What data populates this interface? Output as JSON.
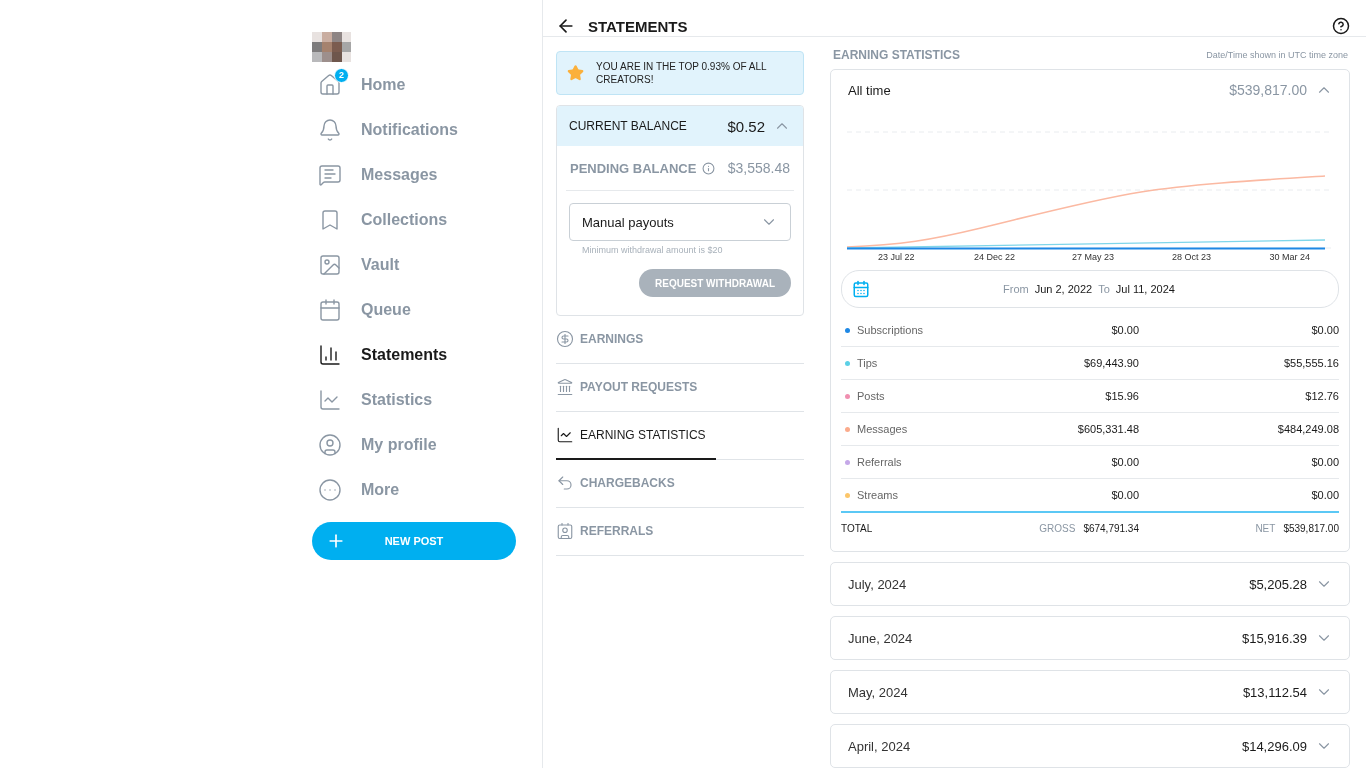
{
  "header": {
    "title": "STATEMENTS"
  },
  "sidebar": {
    "items": [
      {
        "label": "Home",
        "badge": "2",
        "selected": false
      },
      {
        "label": "Notifications",
        "selected": false
      },
      {
        "label": "Messages",
        "selected": false
      },
      {
        "label": "Collections",
        "selected": false
      },
      {
        "label": "Vault",
        "selected": false
      },
      {
        "label": "Queue",
        "selected": false
      },
      {
        "label": "Statements",
        "selected": true
      },
      {
        "label": "Statistics",
        "selected": false
      },
      {
        "label": "My profile",
        "selected": false
      },
      {
        "label": "More",
        "selected": false
      }
    ],
    "new_post": "NEW POST"
  },
  "rank_banner": "YOU ARE IN THE TOP 0.93% OF ALL CREATORS!",
  "balance": {
    "label": "CURRENT BALANCE",
    "amount": "$0.52",
    "expanded": true,
    "pending_label": "PENDING BALANCE",
    "pending_amount": "$3,558.48",
    "payout_mode": "Manual payouts",
    "hint": "Minimum withdrawal amount is $20",
    "withdraw_button": {
      "label": "REQUEST WITHDRAWAL",
      "disabled": true
    }
  },
  "tabs": [
    {
      "label": "EARNINGS",
      "selected": false
    },
    {
      "label": "PAYOUT REQUESTS",
      "selected": false
    },
    {
      "label": "EARNING STATISTICS",
      "selected": true
    },
    {
      "label": "CHARGEBACKS",
      "selected": false
    },
    {
      "label": "REFERRALS",
      "selected": false
    }
  ],
  "earning_statistics": {
    "title": "EARNING STATISTICS",
    "timezone_note": "Date/Time shown in UTC time zone",
    "summary": {
      "label": "All time",
      "amount": "$539,817.00",
      "expanded": true
    },
    "chart_x_labels": [
      "23 Jul 22",
      "24 Dec 22",
      "27 May 23",
      "28 Oct 23",
      "30 Mar 24"
    ],
    "date_range": {
      "from_label": "From",
      "from": "Jun 2, 2022",
      "to_label": "To",
      "to": "Jul 11, 2024"
    },
    "rows": [
      {
        "name": "Subscriptions",
        "color": "#1e88e5",
        "gross": "$0.00",
        "net": "$0.00"
      },
      {
        "name": "Tips",
        "color": "#5bd0e6",
        "gross": "$69,443.90",
        "net": "$55,555.16"
      },
      {
        "name": "Posts",
        "color": "#f08fb0",
        "gross": "$15.96",
        "net": "$12.76"
      },
      {
        "name": "Messages",
        "color": "#fbab8c",
        "gross": "$605,331.48",
        "net": "$484,249.08"
      },
      {
        "name": "Referrals",
        "color": "#c5a8e8",
        "gross": "$0.00",
        "net": "$0.00"
      },
      {
        "name": "Streams",
        "color": "#fcc66a",
        "gross": "$0.00",
        "net": "$0.00"
      }
    ],
    "total": {
      "label": "TOTAL",
      "gross_label": "GROSS",
      "gross": "$674,791.34",
      "net_label": "NET",
      "net": "$539,817.00"
    }
  },
  "months": [
    {
      "label": "July, 2024",
      "amount": "$5,205.28",
      "expanded": false
    },
    {
      "label": "June, 2024",
      "amount": "$15,916.39",
      "expanded": false
    },
    {
      "label": "May, 2024",
      "amount": "$13,112.54",
      "expanded": false
    },
    {
      "label": "April, 2024",
      "amount": "$14,296.09",
      "expanded": false
    }
  ]
}
